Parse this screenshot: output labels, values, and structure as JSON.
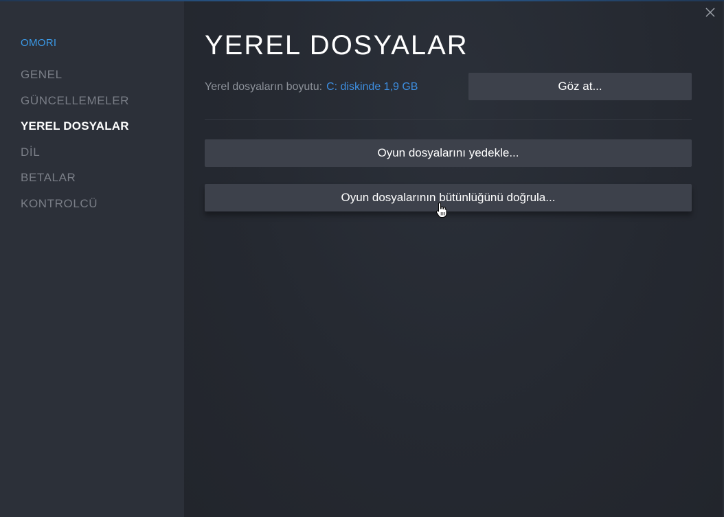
{
  "window": {
    "close_icon": "close-icon"
  },
  "sidebar": {
    "game_title": "OMORI",
    "items": [
      {
        "label": "GENEL",
        "active": false
      },
      {
        "label": "GÜNCELLEMELER",
        "active": false
      },
      {
        "label": "YEREL DOSYALAR",
        "active": true
      },
      {
        "label": "DİL",
        "active": false
      },
      {
        "label": "BETALAR",
        "active": false
      },
      {
        "label": "KONTROLCÜ",
        "active": false
      }
    ]
  },
  "main": {
    "title": "YEREL DOSYALAR",
    "size_label": "Yerel dosyaların boyutu:",
    "size_value": "C: diskinde 1,9 GB",
    "browse_label": "Göz at...",
    "backup_label": "Oyun dosyalarını yedekle...",
    "verify_label": "Oyun dosyalarının bütünlüğünü doğrula..."
  },
  "colors": {
    "accent": "#3b9ae8",
    "sidebar_bg": "#2c3039",
    "main_bg": "#262a33",
    "button_bg": "#3d414b"
  }
}
